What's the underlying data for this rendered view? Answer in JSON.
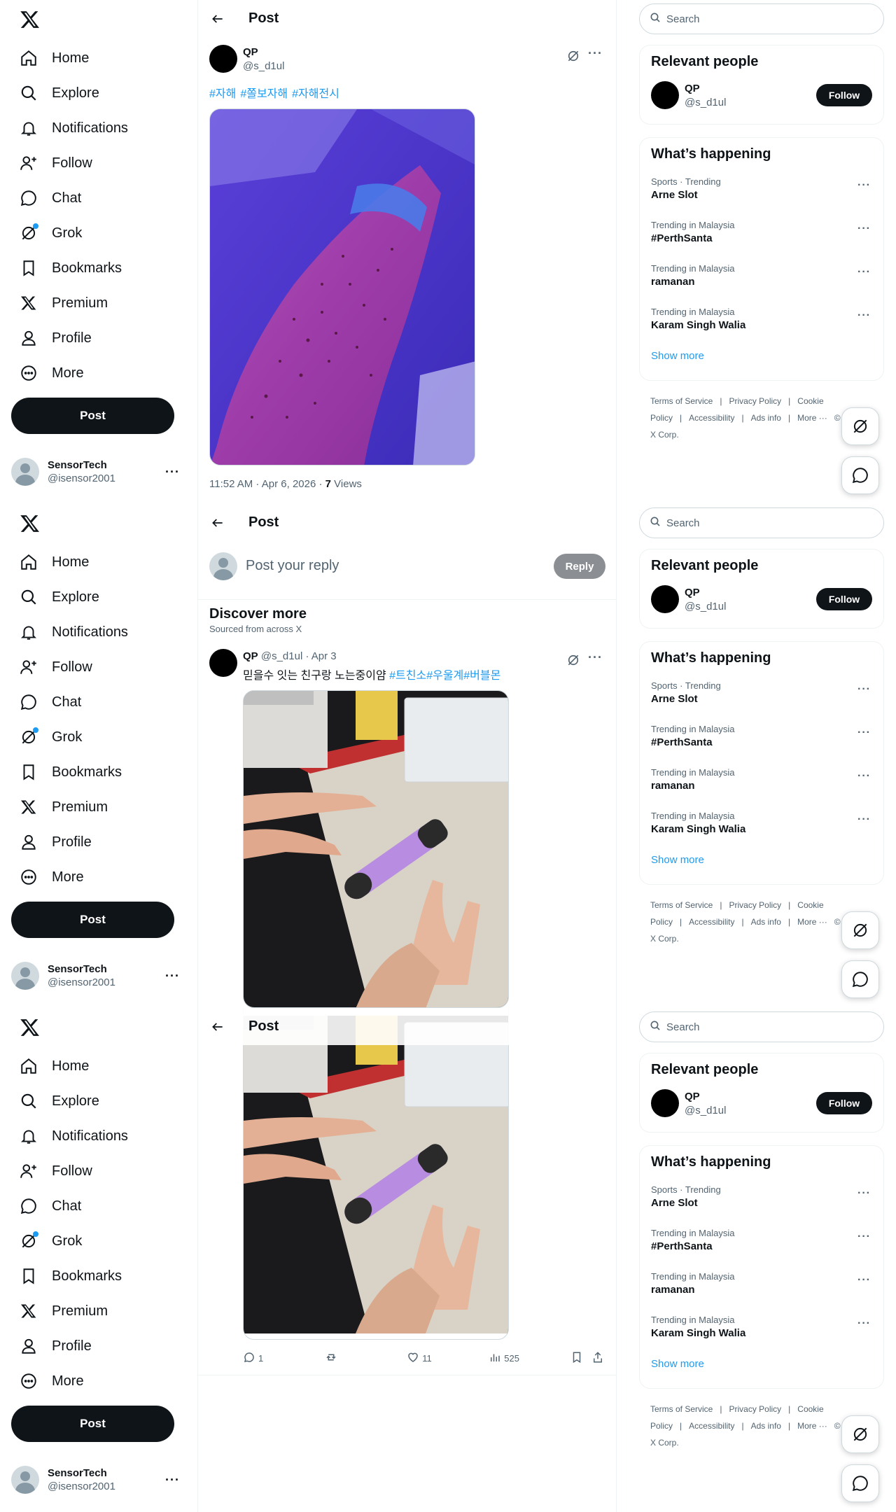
{
  "nav": {
    "items": [
      {
        "label": "Home",
        "icon": "home-icon"
      },
      {
        "label": "Explore",
        "icon": "search-icon"
      },
      {
        "label": "Notifications",
        "icon": "bell-icon"
      },
      {
        "label": "Follow",
        "icon": "person-plus-icon"
      },
      {
        "label": "Chat",
        "icon": "chat-bubble-icon"
      },
      {
        "label": "Grok",
        "icon": "grok-icon"
      },
      {
        "label": "Bookmarks",
        "icon": "bookmark-icon"
      },
      {
        "label": "Premium",
        "icon": "x-logo-icon"
      },
      {
        "label": "Profile",
        "icon": "person-icon"
      },
      {
        "label": "More",
        "icon": "more-circle-icon"
      }
    ],
    "post_label": "Post"
  },
  "account": {
    "name": "SensorTech",
    "handle": "@isensor2001"
  },
  "header": {
    "title": "Post"
  },
  "post": {
    "author": "QP",
    "handle": "@s_d1ul",
    "hashtags": [
      "#자해",
      "#쫄보자해",
      "#자해전시"
    ],
    "timestamp": "11:52 AM · Apr 6, 2026 · ",
    "views_count": "7",
    "views_label": " Views"
  },
  "reply": {
    "placeholder": "Post your reply",
    "button": "Reply"
  },
  "discover": {
    "title": "Discover more",
    "subtitle": "Sourced from across X"
  },
  "feed_post": {
    "author": "QP",
    "handle_date": " @s_d1ul · Apr 3",
    "text": "믿을수 잇는 친구랑 노는중이얌 ",
    "tags": [
      "#트친소",
      "#우울계",
      "#버블몬"
    ],
    "replies": "1",
    "likes": "11",
    "views": "525"
  },
  "search": {
    "placeholder": "Search"
  },
  "relevant": {
    "title": "Relevant people",
    "name": "QP",
    "handle": "@s_d1ul",
    "follow": "Follow"
  },
  "happening": {
    "title": "What’s happening",
    "trends": [
      {
        "meta": "Sports · Trending",
        "name": "Arne Slot"
      },
      {
        "meta": "Trending in Malaysia",
        "name": "#PerthSanta"
      },
      {
        "meta": "Trending in Malaysia",
        "name": "ramanan"
      },
      {
        "meta": "Trending in Malaysia",
        "name": "Karam Singh Walia"
      }
    ],
    "show_more": "Show more"
  },
  "footer": {
    "links": [
      "Terms of Service",
      "|",
      "Privacy Policy",
      "|",
      "Cookie Policy",
      "|",
      "Accessibility",
      "|",
      "Ads info",
      "|",
      "More ···",
      "© 2026 X Corp."
    ]
  },
  "colors": {
    "accent": "#1d9bf0",
    "text": "#0f1419",
    "muted": "#536471"
  }
}
